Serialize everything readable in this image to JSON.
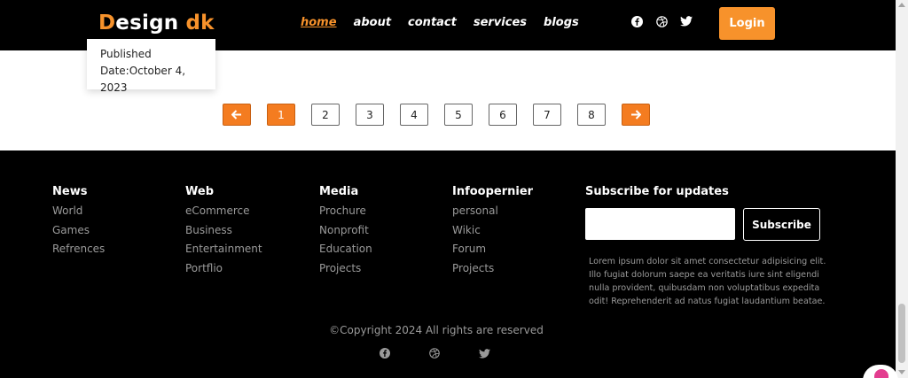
{
  "header": {
    "logo_first": "D",
    "logo_mid": "esign ",
    "logo_last": "dk",
    "nav": [
      "home",
      "about",
      "contact",
      "services",
      "blogs"
    ],
    "login_label": "Login"
  },
  "card": {
    "published": "Published",
    "date": "Date:October 4, 2023"
  },
  "pagination": {
    "prev_icon": "arrow-left-icon",
    "pages": [
      "1",
      "2",
      "3",
      "4",
      "5",
      "6",
      "7",
      "8"
    ],
    "current_page": "1",
    "next_icon": "arrow-right-icon"
  },
  "footer": {
    "columns": [
      {
        "title": "News",
        "links": [
          "World",
          "Games",
          "Refrences"
        ]
      },
      {
        "title": "Web",
        "links": [
          "eCommerce",
          "Business",
          "Entertainment",
          "Portflio"
        ]
      },
      {
        "title": "Media",
        "links": [
          "Prochure",
          "Nonprofit",
          "Education",
          "Projects"
        ]
      },
      {
        "title": "Infoopernier",
        "links": [
          "personal",
          "Wikic",
          "Forum",
          "Projects"
        ]
      }
    ],
    "subscribe_title": "Subscribe for updates",
    "subscribe_input_value": "",
    "subscribe_button": "Subscribe",
    "lorem": "Lorem ipsum dolor sit amet consectetur adipisicing elit. Illo fugiat dolorum saepe ea veritatis iure sint eligendi nulla provident, quibusdam non voluptatibus expedita odit! Reprehenderit ad natus fugiat laudantium beatae.",
    "copyright": "©Copyright 2024 All rights are reserved"
  },
  "social_icons": [
    "facebook-icon",
    "dribbble-icon",
    "twitter-icon"
  ],
  "colors": {
    "accent": "#f7922b",
    "pager_orange": "#f47c20",
    "background_dark": "#000000",
    "muted_text": "#9a9a9a"
  }
}
